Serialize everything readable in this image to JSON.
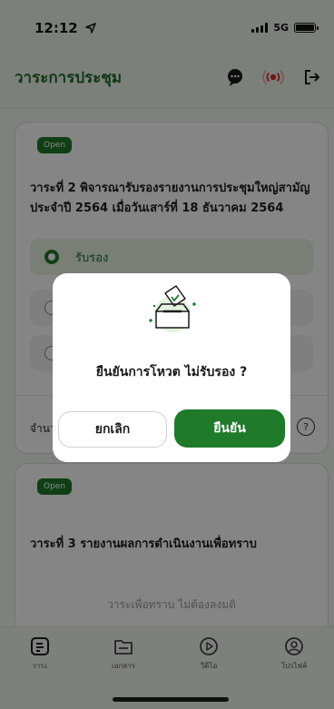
{
  "status_bar": {
    "time": "12:12",
    "network": "5G"
  },
  "header": {
    "title": "วาระการประชุม"
  },
  "agenda_items": [
    {
      "badge": "Open",
      "text": "วาระที่ 2 พิจารณารับรองรายงานการประชุมใหญ่สามัญประจำปี 2564 เมื่อวันเสาร์ที่ 18 ธันวาคม 2564",
      "selected_option": "รับรอง",
      "count_label": "จำนวน"
    },
    {
      "badge": "Open",
      "text": "วาระที่ 3 รายงานผลการดำเนินงานเพื่อทราบ",
      "note": "วาระเพื่อทราบ ไม่ต้องลงมติ"
    }
  ],
  "tabs": [
    {
      "label": "วาระ"
    },
    {
      "label": "เอกสาร"
    },
    {
      "label": "วีดีโอ"
    },
    {
      "label": "โปรไฟล์"
    }
  ],
  "modal": {
    "message": "ยืนยันการโหวต  ไม่รับรอง ?",
    "cancel_label": "ยกเลิก",
    "confirm_label": "ยืนยัน"
  },
  "colors": {
    "accent": "#1f7a2a",
    "header_bg": "#eef5ec",
    "overlay": "rgba(0,0,0,0.48)"
  },
  "icons": [
    "location-arrow-icon",
    "chat-icon",
    "broadcast-icon",
    "logout-icon",
    "ballot-box-icon",
    "agenda-icon",
    "document-icon",
    "video-icon",
    "profile-icon",
    "help-icon"
  ]
}
